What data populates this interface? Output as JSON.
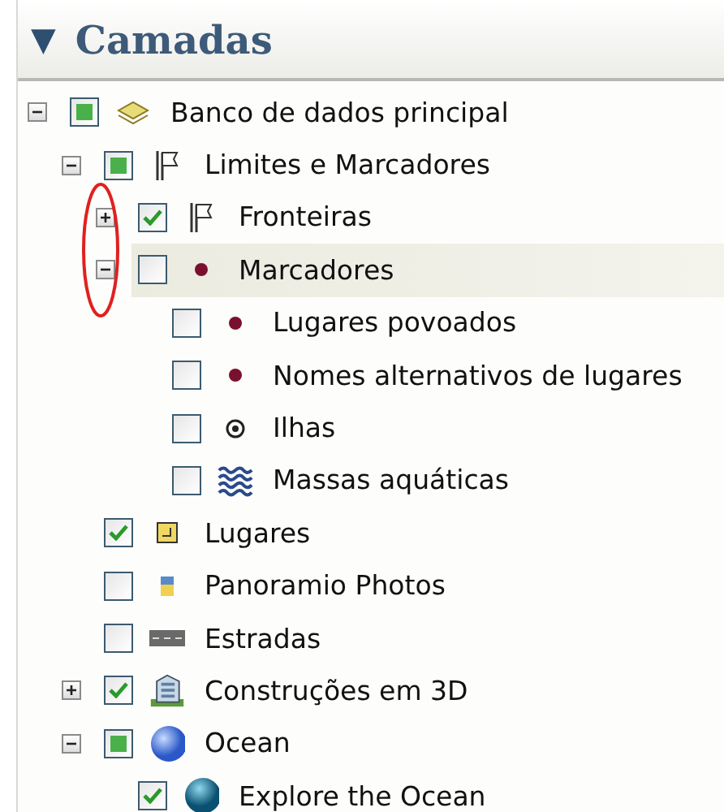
{
  "panel": {
    "toggle": "▼",
    "title": "Camadas"
  },
  "tree": [
    {
      "label": "Banco de dados principal",
      "kind": "database",
      "checked": true,
      "partial": true,
      "expanded": true,
      "selected": false,
      "children": [
        {
          "label": "Limites e Marcadores",
          "kind": "flag",
          "checked": true,
          "partial": true,
          "expanded": true,
          "selected": false,
          "children": [
            {
              "label": "Fronteiras",
              "kind": "flag",
              "checked": true,
              "partial": false,
              "expanded": false,
              "selected": false
            },
            {
              "label": "Marcadores",
              "kind": "dot",
              "checked": false,
              "partial": false,
              "expanded": true,
              "selected": true,
              "children": [
                {
                  "label": "Lugares povoados",
                  "kind": "dot",
                  "checked": false,
                  "partial": false,
                  "selected": false
                },
                {
                  "label": "Nomes alternativos de lugares",
                  "kind": "dot",
                  "checked": false,
                  "partial": false,
                  "selected": false
                },
                {
                  "label": "Ilhas",
                  "kind": "target",
                  "checked": false,
                  "partial": false,
                  "selected": false
                },
                {
                  "label": "Massas aquáticas",
                  "kind": "water",
                  "checked": false,
                  "partial": false,
                  "selected": false
                }
              ]
            }
          ]
        },
        {
          "label": "Lugares",
          "kind": "square",
          "checked": true,
          "partial": false,
          "selected": false
        },
        {
          "label": "Panoramio Photos",
          "kind": "photo",
          "checked": false,
          "partial": false,
          "selected": false
        },
        {
          "label": "Estradas",
          "kind": "road",
          "checked": false,
          "partial": false,
          "selected": false
        },
        {
          "label": "Construções em 3D",
          "kind": "building",
          "checked": true,
          "partial": false,
          "expanded": false,
          "selected": false
        },
        {
          "label": "Ocean",
          "kind": "globe",
          "checked": true,
          "partial": true,
          "expanded": true,
          "selected": false,
          "children": [
            {
              "label": "Explore the Ocean",
              "kind": "sphere",
              "checked": true,
              "partial": false,
              "selected": false
            }
          ]
        }
      ]
    }
  ]
}
